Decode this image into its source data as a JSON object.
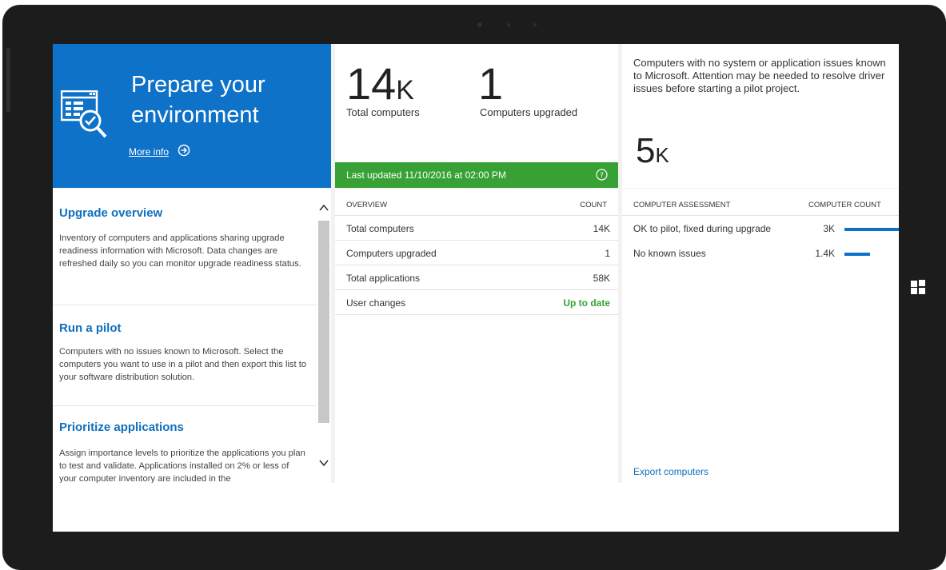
{
  "hero": {
    "title": "Prepare your environment",
    "more_info": "More info"
  },
  "sections": [
    {
      "title": "Upgrade overview",
      "body": "Inventory of computers and applications sharing upgrade readiness information with Microsoft. Data changes are refreshed daily so you can monitor upgrade readiness status."
    },
    {
      "title": "Run a pilot",
      "body": "Computers with no issues known to Microsoft. Select the computers you want to use in a pilot and then export this list to your software distribution solution."
    },
    {
      "title": "Prioritize applications",
      "body": "Assign importance levels to prioritize the applications you plan to test and validate. Applications installed on 2% or less of your computer inventory are included in the"
    }
  ],
  "stats": {
    "total_num": "14",
    "total_suffix": "K",
    "total_label": "Total computers",
    "upgraded_num": "1",
    "upgraded_label": "Computers upgraded",
    "updated": "Last updated 11/10/2016 at 02:00 PM"
  },
  "overview": {
    "col1": "OVERVIEW",
    "col2": "COUNT",
    "rows": [
      {
        "label": "Total computers",
        "value": "14K"
      },
      {
        "label": "Computers upgraded",
        "value": "1"
      },
      {
        "label": "Total applications",
        "value": "58K"
      },
      {
        "label": "User changes",
        "value": "Up to date"
      }
    ]
  },
  "assessment": {
    "description": "Computers with no system or application issues known to Microsoft. Attention may be needed to resolve driver issues before starting a pilot project.",
    "big_num": "5",
    "big_suffix": "K",
    "col1": "COMPUTER ASSESSMENT",
    "col2": "COMPUTER COUNT",
    "rows": [
      {
        "label": "OK to pilot, fixed during upgrade",
        "value": "3K",
        "fraction": 1.0
      },
      {
        "label": "No known issues",
        "value": "1.4K",
        "fraction": 0.47
      }
    ],
    "export": "Export computers"
  },
  "colors": {
    "accent": "#0e72c9",
    "success": "#37a135",
    "bezel": "#1c1c1c"
  }
}
